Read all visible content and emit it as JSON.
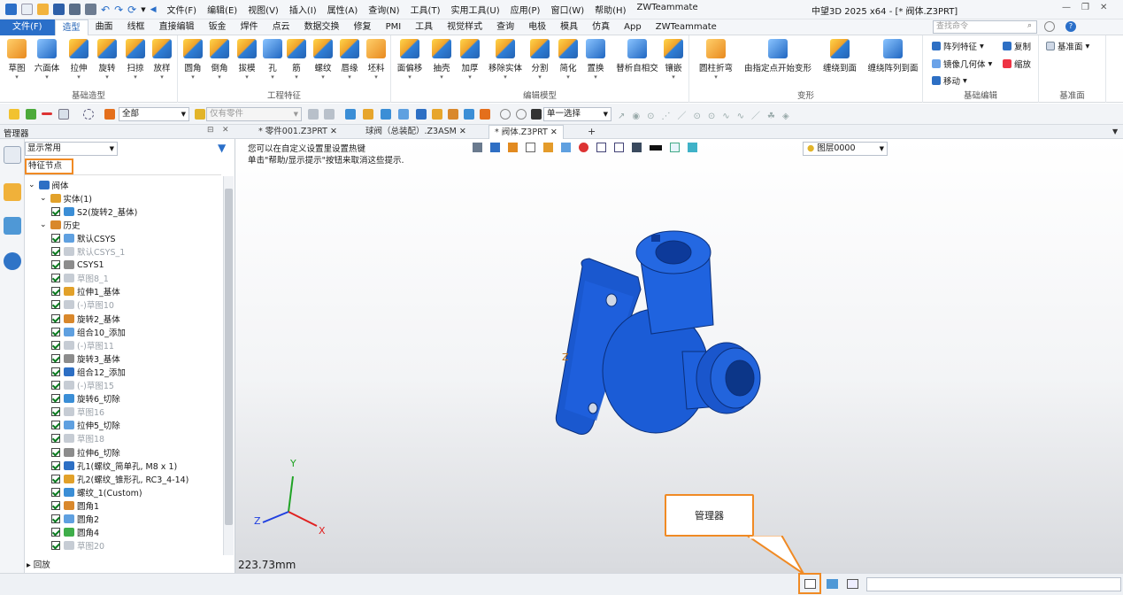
{
  "titlebar": {
    "menus": [
      "文件(F)",
      "编辑(E)",
      "视图(V)",
      "插入(I)",
      "属性(A)",
      "查询(N)",
      "工具(T)",
      "实用工具(U)",
      "应用(P)",
      "窗口(W)",
      "帮助(H)",
      "ZWTeammate"
    ],
    "title": "中望3D 2025 x64 - [* 阀体.Z3PRT]"
  },
  "tabs": {
    "items": [
      "文件(F)",
      "造型",
      "曲面",
      "线框",
      "直接编辑",
      "钣金",
      "焊件",
      "点云",
      "数据交换",
      "修复",
      "PMI",
      "工具",
      "视觉样式",
      "查询",
      "电极",
      "模具",
      "仿真",
      "App",
      "ZWTeammate"
    ],
    "active": "造型",
    "search_placeholder": "查找命令"
  },
  "ribbon": {
    "groups": {
      "basic": "基础造型",
      "engineering": "工程特征",
      "edit_model": "编辑模型",
      "deform": "变形",
      "basic_edit": "基础编辑",
      "datum": "基准面"
    },
    "basic_tools": [
      "草图",
      "六面体",
      "拉伸",
      "旋转",
      "扫掠",
      "放样"
    ],
    "eng_tools": [
      "圆角",
      "倒角",
      "拔模",
      "孔",
      "筋",
      "螺纹",
      "唇缘",
      "坯料"
    ],
    "edit_tools": [
      "面偏移",
      "抽壳",
      "加厚",
      "移除实体",
      "分割",
      "简化",
      "置换",
      "镶嵌"
    ],
    "edit_extra": "替析自相交",
    "deform_tools": [
      "圆柱折弯",
      "由指定点开始变形",
      "缠绕到面",
      "缠绕阵列到面"
    ],
    "basic_edit_items": [
      "阵列特征",
      "复制",
      "镜像几何体",
      "缩放",
      "移动"
    ],
    "datum_item": "基准面"
  },
  "toolbar2": {
    "filter": "全部",
    "part_only": "仅有零件",
    "pick_mode": "单一选择"
  },
  "manager": {
    "title": "管理器",
    "display_mode": "显示常用",
    "feature_node": "特征节点",
    "history_label": "回放",
    "rows": [
      {
        "text": "阀体",
        "indent": 0,
        "check": false,
        "gray": false
      },
      {
        "text": "实体(1)",
        "indent": 1,
        "check": false,
        "gray": false
      },
      {
        "text": "S2(旋转2_基体)",
        "indent": 2,
        "check": true,
        "gray": false
      },
      {
        "text": "历史",
        "indent": 1,
        "check": false,
        "gray": false
      },
      {
        "text": "默认CSYS",
        "indent": 2,
        "check": true,
        "gray": false
      },
      {
        "text": "默认CSYS_1",
        "indent": 2,
        "check": true,
        "gray": true
      },
      {
        "text": "CSYS1",
        "indent": 2,
        "check": true,
        "gray": false
      },
      {
        "text": "草图8_1",
        "indent": 2,
        "check": true,
        "gray": true
      },
      {
        "text": "拉伸1_基体",
        "indent": 2,
        "check": true,
        "gray": false
      },
      {
        "text": "(-)草图10",
        "indent": 2,
        "check": true,
        "gray": true
      },
      {
        "text": "旋转2_基体",
        "indent": 2,
        "check": true,
        "gray": false
      },
      {
        "text": "组合10_添加",
        "indent": 2,
        "check": true,
        "gray": false
      },
      {
        "text": "(-)草图11",
        "indent": 2,
        "check": true,
        "gray": true
      },
      {
        "text": "旋转3_基体",
        "indent": 2,
        "check": true,
        "gray": false
      },
      {
        "text": "组合12_添加",
        "indent": 2,
        "check": true,
        "gray": false
      },
      {
        "text": "(-)草图15",
        "indent": 2,
        "check": true,
        "gray": true
      },
      {
        "text": "旋转6_切除",
        "indent": 2,
        "check": true,
        "gray": false
      },
      {
        "text": "草图16",
        "indent": 2,
        "check": true,
        "gray": true
      },
      {
        "text": "拉伸5_切除",
        "indent": 2,
        "check": true,
        "gray": false
      },
      {
        "text": "草图18",
        "indent": 2,
        "check": true,
        "gray": true
      },
      {
        "text": "拉伸6_切除",
        "indent": 2,
        "check": true,
        "gray": false
      },
      {
        "text": "孔1(螺纹_简单孔, M8 x 1)",
        "indent": 2,
        "check": true,
        "gray": false
      },
      {
        "text": "孔2(螺纹_锥形孔, RC3_4-14)",
        "indent": 2,
        "check": true,
        "gray": false
      },
      {
        "text": "螺纹_1(Custom)",
        "indent": 2,
        "check": true,
        "gray": false
      },
      {
        "text": "圆角1",
        "indent": 2,
        "check": true,
        "gray": false
      },
      {
        "text": "圆角2",
        "indent": 2,
        "check": true,
        "gray": false
      },
      {
        "text": "圆角4",
        "indent": 2,
        "check": true,
        "gray": false
      },
      {
        "text": "草图20",
        "indent": 2,
        "check": true,
        "gray": true
      }
    ]
  },
  "doctabs": [
    "* 零件001.Z3PRT",
    "球阀（总装配）.Z3ASM",
    "* 阀体.Z3PRT"
  ],
  "viewport": {
    "hint1": "您可以在自定义设置里设置热键",
    "hint2": "单击\"帮助/显示提示\"按钮来取消这些提示.",
    "layer": "图层0000",
    "scale": "223.73mm",
    "axis_x": "X",
    "axis_y": "Y",
    "axis_z": "Z",
    "model_axis": "Z"
  },
  "callout": {
    "text": "管理器"
  },
  "colors": {
    "accent": "#2a6fc9",
    "highlight": "#f08a24",
    "model": "#1e5fd6"
  }
}
